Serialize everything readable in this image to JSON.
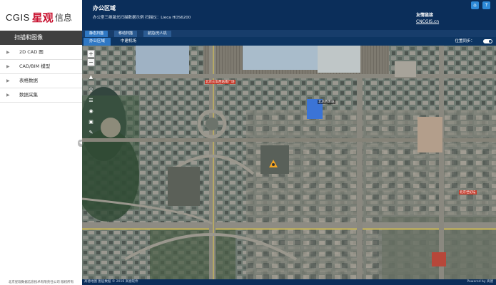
{
  "brand": {
    "latin": "CGIS",
    "name": "星观",
    "suffix": "信息"
  },
  "sidebar": {
    "section_title": "扫描和图像",
    "items": [
      {
        "label": "2D CAD 图"
      },
      {
        "label": "CAD/BIM 模型"
      },
      {
        "label": "表格数据"
      },
      {
        "label": "数据采集"
      }
    ],
    "footer": "北京星观数据信息技术有限责任公司 版权所有"
  },
  "header": {
    "title": "办公区域",
    "subtitle": "办公室三维激光扫描数据示例 扫描仪：Lieca HDS6200",
    "links_title": "友情链接",
    "link": "CNCGIS.cn",
    "home_icon": "home-icon",
    "help_icon": "help-icon"
  },
  "tabs": [
    {
      "label": "静态扫描",
      "active": true
    },
    {
      "label": "移动扫描",
      "active": false
    },
    {
      "label": "航拍/无人机",
      "active": false
    }
  ],
  "subtabs": [
    {
      "label": "办公区域",
      "active": true
    },
    {
      "label": "中建机场",
      "active": false
    }
  ],
  "sync": {
    "label": "位置同步："
  },
  "map": {
    "labels": [
      {
        "text": "北京火车西站南广场"
      },
      {
        "text": "北京西客站"
      },
      {
        "text": "北京世纪坛"
      }
    ],
    "bottom_left": "高德地图 图层数据 © 2016 高德软件",
    "bottom_right": "Powered by 高德"
  },
  "colors": {
    "header_bg": "#0b2e5a",
    "accent": "#2f78c4",
    "brand_red": "#c8102e",
    "marker": "#f5a623"
  }
}
